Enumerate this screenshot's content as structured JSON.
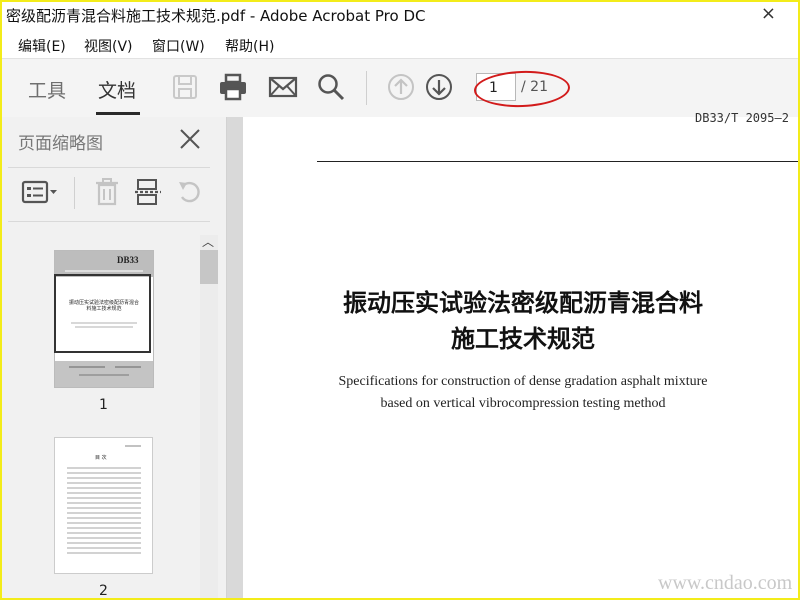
{
  "window": {
    "title": "密级配沥青混合料施工技术规范.pdf - Adobe Acrobat Pro DC",
    "close_glyph": "×"
  },
  "menu": {
    "items": [
      "编辑(E)",
      "视图(V)",
      "窗口(W)",
      "帮助(H)"
    ]
  },
  "toolbar": {
    "tab_tools": "工具",
    "tab_document": "文档",
    "icons": [
      "save-icon",
      "print-icon",
      "email-icon",
      "search-icon",
      "page-up-icon",
      "page-down-icon"
    ],
    "page_current": "1",
    "page_total": "/ 21"
  },
  "panel": {
    "title": "页面缩略图",
    "tools": [
      "thumbnail-options-icon",
      "delete-icon",
      "page-layout-icon",
      "rotate-icon"
    ],
    "thumbnails": [
      {
        "label": "1",
        "header": "DB33",
        "title_text": "振动压实试验法密级配沥青混合料施工技术规范"
      },
      {
        "label": "2",
        "title_text": "目 次"
      }
    ]
  },
  "document": {
    "header_code": "DB33/T 2095—2",
    "title_line1": "振动压实试验法密级配沥青混合料",
    "title_line2": "施工技术规范",
    "subtitle_line1": "Specifications for construction of dense gradation asphalt mixture",
    "subtitle_line2": "based on vertical vibrocompression testing method"
  },
  "watermark": "www.cndao.com",
  "colors": {
    "border": "#f3ec1a",
    "annotation_red": "#d21b1b",
    "toolbar_bg": "#f4f4f4"
  }
}
